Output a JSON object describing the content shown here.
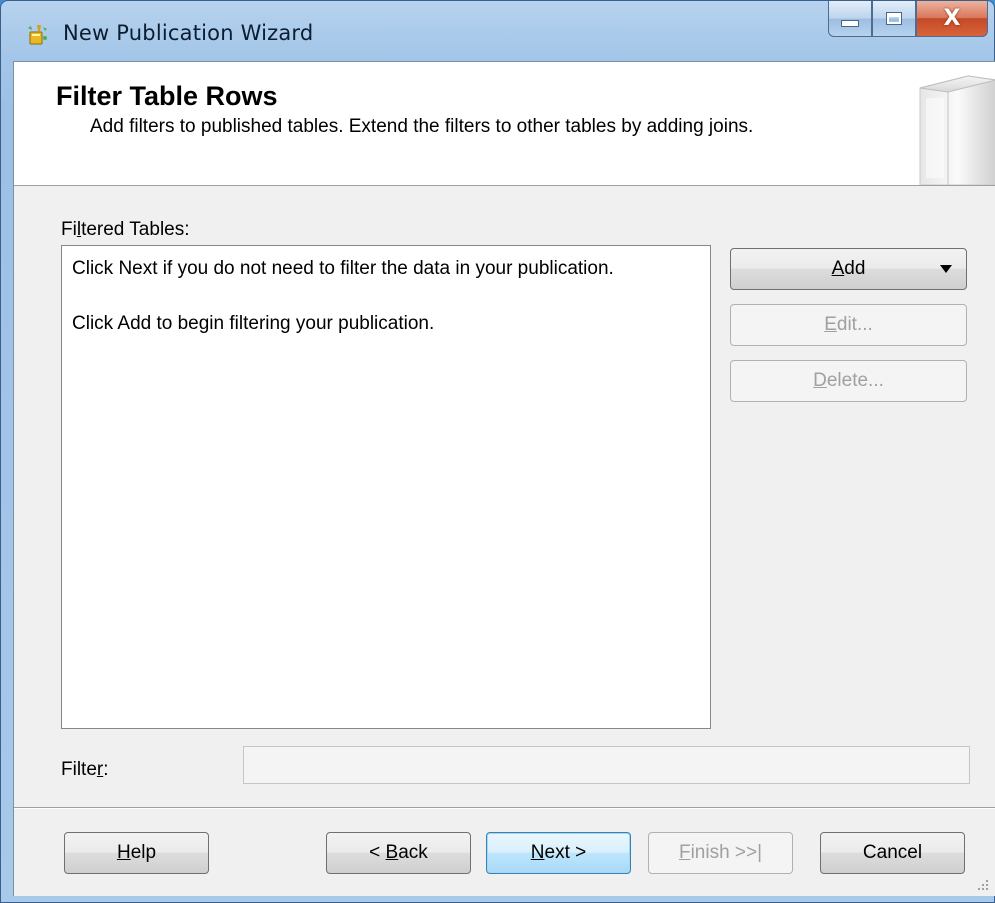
{
  "window": {
    "title": "New Publication Wizard",
    "close_glyph": "X"
  },
  "header": {
    "title": "Filter Table Rows",
    "description": "Add filters to published tables. Extend the filters to other tables by adding joins."
  },
  "filtered_tables": {
    "label_pre": "Fi",
    "label_access": "l",
    "label_post": "tered Tables:",
    "lines": [
      "Click Next if you do not need to filter the data in your publication.",
      "Click Add to begin filtering your publication."
    ]
  },
  "side_buttons": {
    "add_access": "A",
    "add_rest": "dd",
    "edit_access": "E",
    "edit_rest": "dit...",
    "delete_access": "D",
    "delete_rest": "elete..."
  },
  "filter": {
    "label_pre": "Filte",
    "label_access": "r",
    "label_post": ":",
    "value": ""
  },
  "footer": {
    "help_access": "H",
    "help_rest": "elp",
    "back_pre": "< ",
    "back_access": "B",
    "back_rest": "ack",
    "next_access": "N",
    "next_rest": "ext >",
    "finish_access": "F",
    "finish_rest": "inish >>|",
    "cancel": "Cancel"
  },
  "icons": {
    "app": "publication-wizard-icon",
    "minimize": "minimize-icon",
    "maximize": "maximize-icon",
    "close": "close-icon",
    "dropdown": "dropdown-arrow-icon",
    "header_art": "wizard-banner-icon",
    "resize": "resize-grip-icon"
  }
}
